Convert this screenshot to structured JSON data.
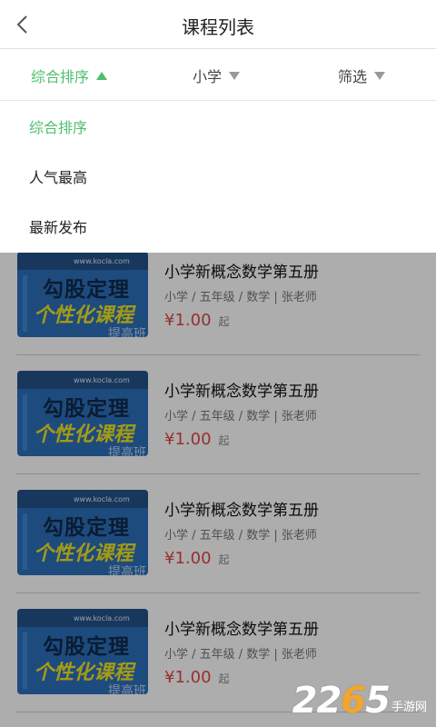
{
  "header": {
    "title": "课程列表",
    "back_icon": "chevron-left-icon"
  },
  "filters": {
    "sort_label": "综合排序",
    "level_label": "小学",
    "filter_label": "筛选",
    "accent_color": "#4fbf6b"
  },
  "dropdown": {
    "items": [
      {
        "label": "综合排序",
        "selected": true
      },
      {
        "label": "人气最高",
        "selected": false
      },
      {
        "label": "最新发布",
        "selected": false
      }
    ]
  },
  "courses": [
    {
      "title": "小学新概念数学第五册",
      "meta": "小学 / 五年级 / 数学  |  张老师",
      "price": "¥1.00",
      "price_suffix": "起",
      "thumb_url": "www.kocla.com",
      "thumb_line1": "勾股定理",
      "thumb_line2": "个性化课程",
      "thumb_line3": "提高班"
    },
    {
      "title": "小学新概念数学第五册",
      "meta": "小学 / 五年级 / 数学  |  张老师",
      "price": "¥1.00",
      "price_suffix": "起",
      "thumb_url": "www.kocla.com",
      "thumb_line1": "勾股定理",
      "thumb_line2": "个性化课程",
      "thumb_line3": "提高班"
    },
    {
      "title": "小学新概念数学第五册",
      "meta": "小学 / 五年级 / 数学  |  张老师",
      "price": "¥1.00",
      "price_suffix": "起",
      "thumb_url": "www.kocla.com",
      "thumb_line1": "勾股定理",
      "thumb_line2": "个性化课程",
      "thumb_line3": "提高班"
    },
    {
      "title": "小学新概念数学第五册",
      "meta": "小学 / 五年级 / 数学  |  张老师",
      "price": "¥1.00",
      "price_suffix": "起",
      "thumb_url": "www.kocla.com",
      "thumb_line1": "勾股定理",
      "thumb_line2": "个性化课程",
      "thumb_line3": "提高班"
    }
  ],
  "watermark": {
    "number_a": "22",
    "number_b": "6",
    "number_c": "5",
    "text": "手游网"
  }
}
